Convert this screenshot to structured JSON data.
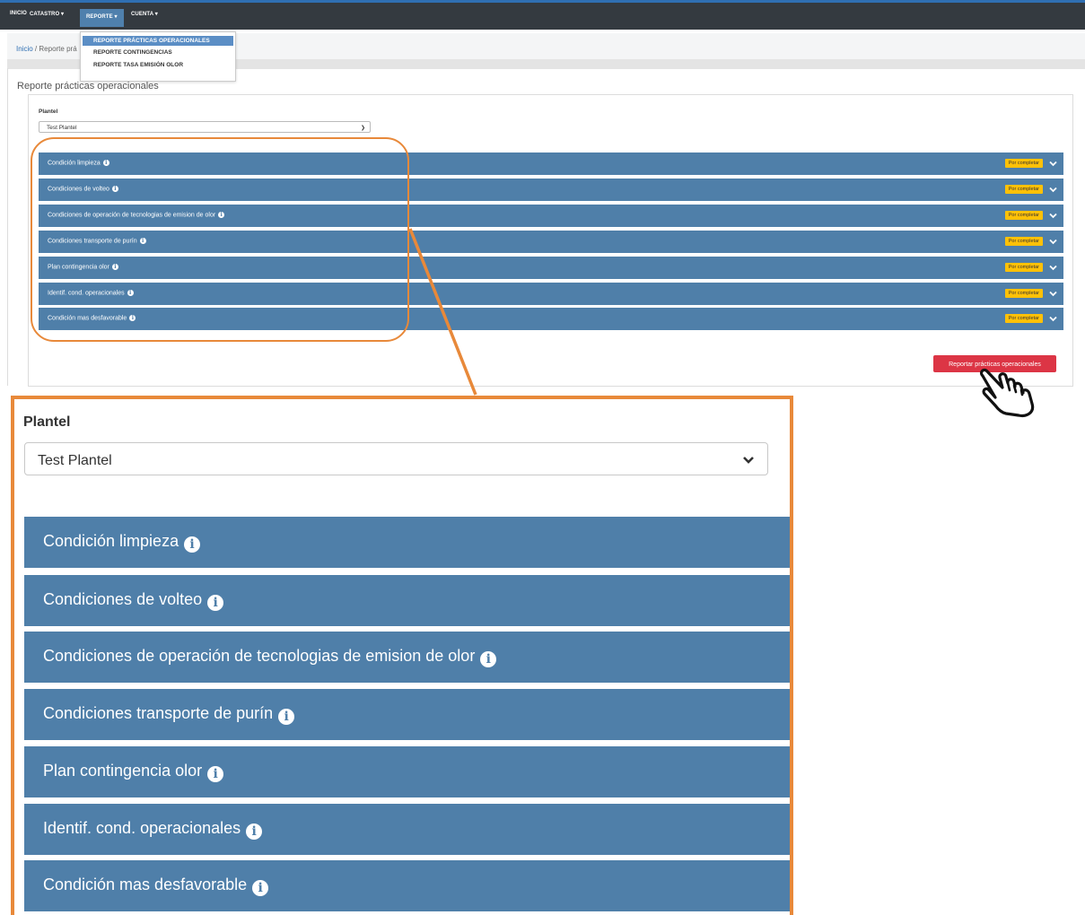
{
  "nav": {
    "items": [
      "INICIO",
      "CATASTRO ▾",
      "REPORTE ▾",
      "CUENTA ▾"
    ]
  },
  "dropdown": {
    "items": [
      "REPORTE PRÁCTICAS OPERACIONALES",
      "REPORTE CONTINGENCIAS",
      "REPORTE TASA EMISIÓN OLOR"
    ]
  },
  "breadcrumb": {
    "home": "Inicio",
    "separator": "/",
    "current": "Reporte prá"
  },
  "page": {
    "title": "Reporte prácticas operacionales"
  },
  "form": {
    "plantel_label": "Plantel",
    "plantel_value": "Test Plantel"
  },
  "accordion": {
    "items": [
      {
        "label": "Condición limpieza",
        "status": "Por completar"
      },
      {
        "label": "Condiciones de volteo",
        "status": "Por completar"
      },
      {
        "label": "Condiciones de operación de tecnologias de emision de olor",
        "status": "Por completar"
      },
      {
        "label": "Condiciones transporte de purín",
        "status": "Por completar"
      },
      {
        "label": "Plan contingencia olor",
        "status": "Por completar"
      },
      {
        "label": "Identif. cond. operacionales",
        "status": "Por completar"
      },
      {
        "label": "Condición mas desfavorable",
        "status": "Por completar"
      }
    ]
  },
  "submit_button": "Reportar prácticas operacionales",
  "icons": {
    "info": "info-icon",
    "chevron": "chevron-down-icon",
    "cursor": "hand-pointer-icon"
  },
  "colors": {
    "accordion": "#4f7fa9",
    "badge": "#ffc107",
    "submit": "#dc3545",
    "annotation": "#e8893a",
    "navbar": "#343a40"
  }
}
